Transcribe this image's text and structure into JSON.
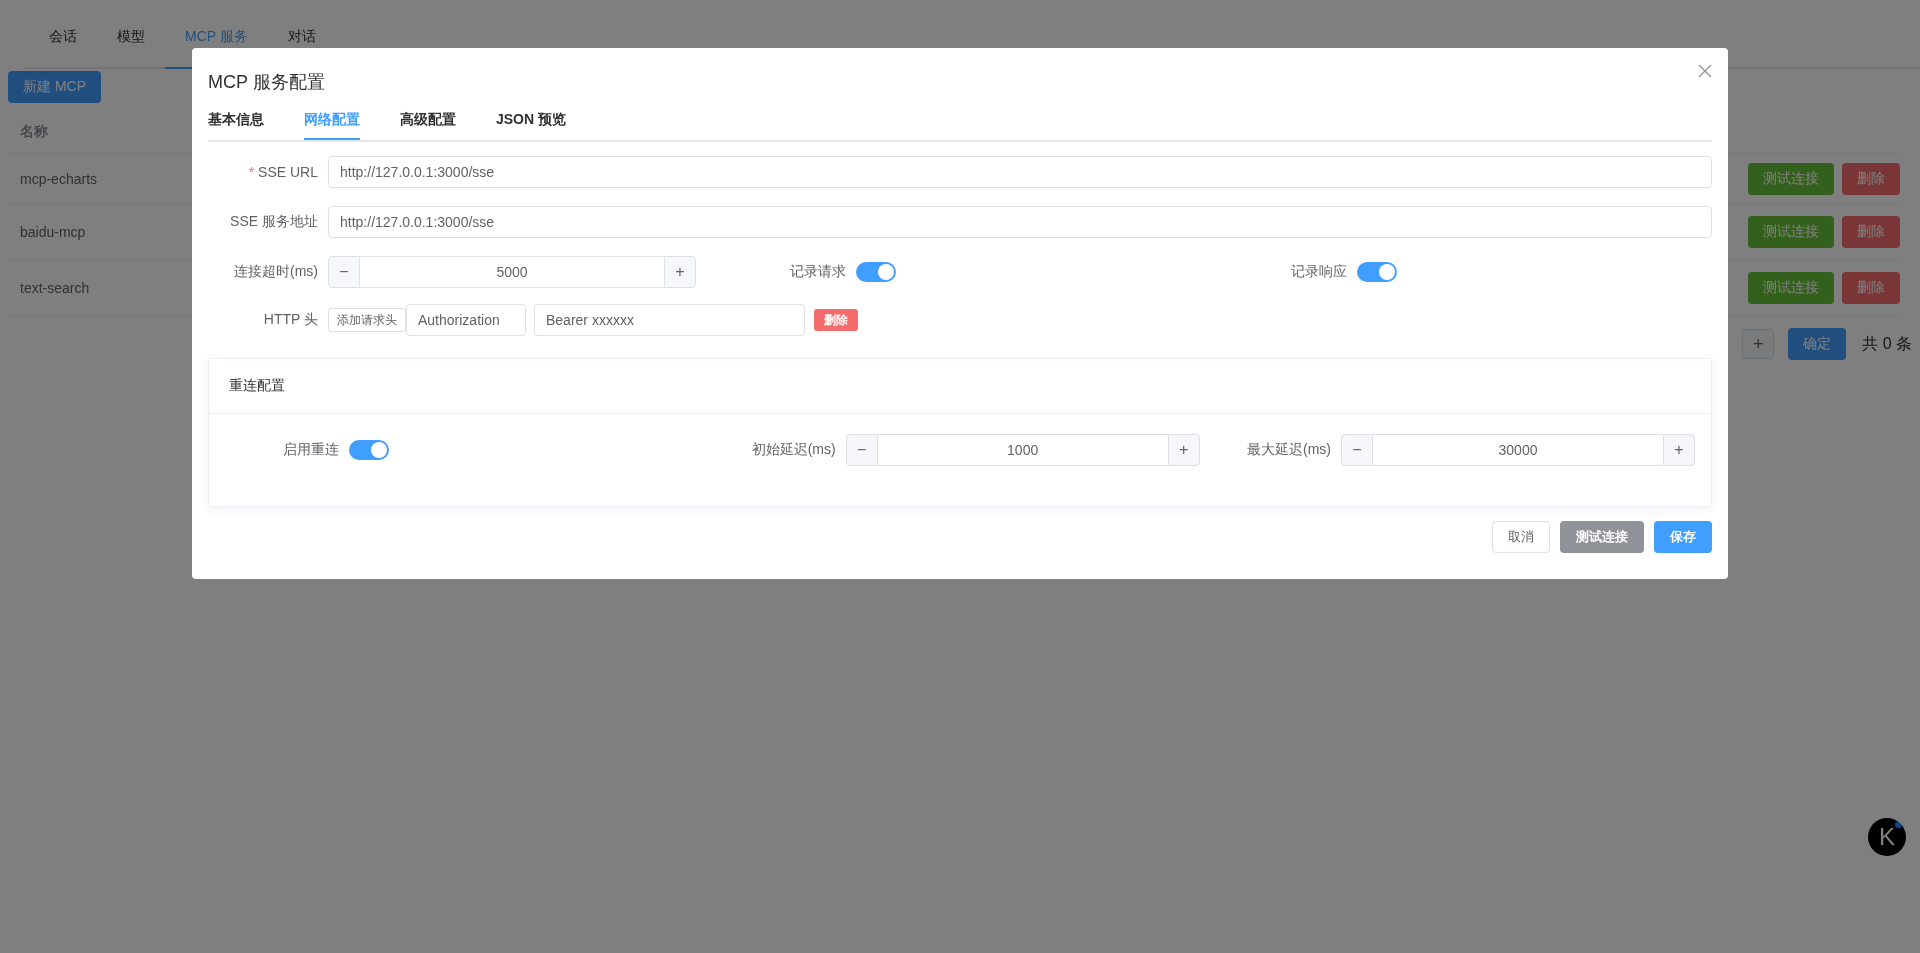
{
  "page": {
    "nav_tabs": [
      {
        "label": "会话",
        "selected": false
      },
      {
        "label": "模型",
        "selected": false
      },
      {
        "label": "MCP 服务",
        "selected": true
      },
      {
        "label": "对话",
        "selected": false
      }
    ],
    "new_button": "新建 MCP",
    "table": {
      "columns": [
        "名称"
      ],
      "rows": [
        {
          "name": "mcp-echarts",
          "test_button": "测试连接",
          "delete_button": "删除"
        },
        {
          "name": "baidu-mcp",
          "test_button": "测试连接",
          "delete_button": "删除"
        },
        {
          "name": "text-search",
          "test_button": "测试连接",
          "delete_button": "删除"
        }
      ]
    },
    "pagination": {
      "increment": "+",
      "confirm": "确定",
      "total": "共 0 条"
    },
    "logo": "K"
  },
  "dialog": {
    "title": "MCP 服务配置",
    "tabs": [
      {
        "label": "基本信息",
        "selected": false
      },
      {
        "label": "网络配置",
        "selected": true
      },
      {
        "label": "高级配置",
        "selected": false
      },
      {
        "label": "JSON 预览",
        "selected": false
      }
    ],
    "rows": [
      {
        "kind": "text",
        "required_mark": "*",
        "label": "SSE URL",
        "value": "http://127.0.0.1:3000/sse"
      },
      {
        "kind": "text",
        "label": "SSE 服务地址",
        "value": "http://127.0.0.1:3000/sse"
      },
      {
        "kind": "inline",
        "items": [
          {
            "kind": "number",
            "label": "连接超时(ms)",
            "value": "5000",
            "decrement": "−",
            "increment": "+"
          },
          {
            "kind": "switch",
            "label": "记录请求",
            "on": true
          },
          {
            "kind": "switch",
            "label": "记录响应",
            "on": true
          }
        ]
      },
      {
        "kind": "headers",
        "label": "HTTP 头",
        "add_button": "添加请求头",
        "key": "Authorization",
        "value": "Bearer xxxxxx",
        "delete_button": "删除"
      }
    ],
    "reconnect": {
      "title": "重连配置",
      "items": [
        {
          "kind": "switch",
          "label": "启用重连",
          "on": true
        },
        {
          "kind": "number",
          "label": "初始延迟(ms)",
          "value": "1000",
          "decrement": "−",
          "increment": "+"
        },
        {
          "kind": "number",
          "label": "最大延迟(ms)",
          "value": "30000",
          "decrement": "−",
          "increment": "+"
        }
      ]
    },
    "footer_buttons": [
      {
        "label": "取消",
        "kind": "default"
      },
      {
        "label": "测试连接",
        "kind": "info"
      },
      {
        "label": "保存",
        "kind": "primary"
      }
    ]
  }
}
